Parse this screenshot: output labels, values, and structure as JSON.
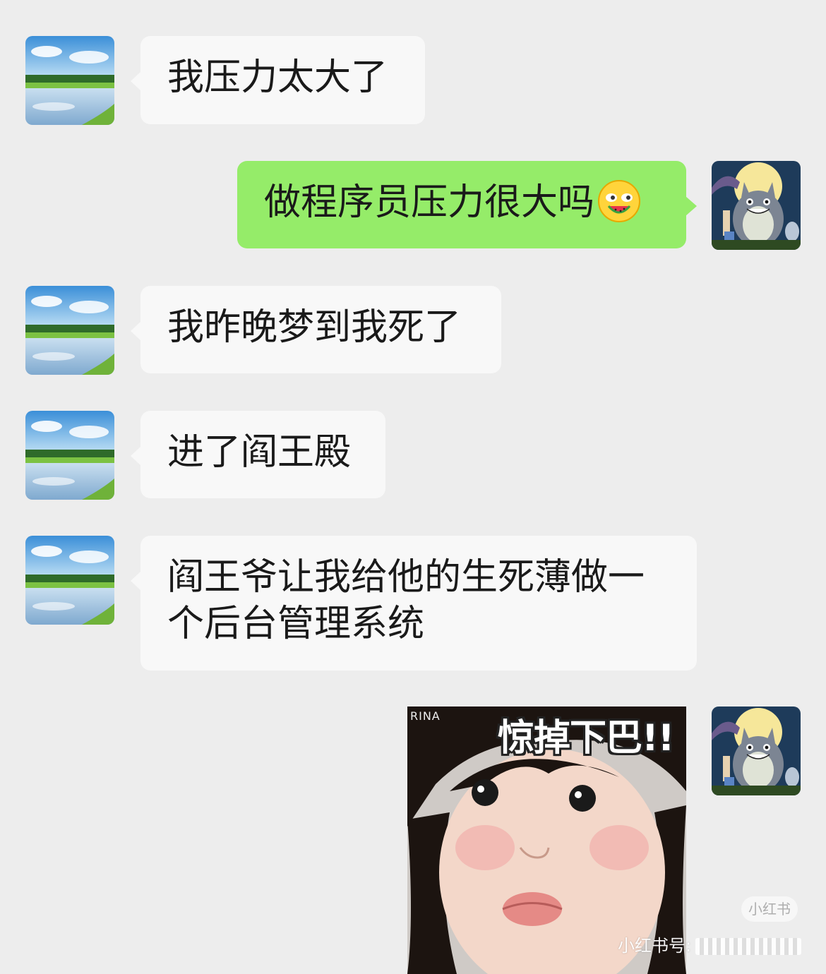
{
  "chat": {
    "messages": [
      {
        "side": "left",
        "text": "我压力太大了"
      },
      {
        "side": "right",
        "text": "做程序员压力很大吗",
        "emoji": "watermelon-eating-face-emoji"
      },
      {
        "side": "left",
        "text": "我昨晚梦到我死了"
      },
      {
        "side": "left",
        "text": "进了阎王殿"
      },
      {
        "side": "left",
        "text": "阎王爷让我给他的生死薄做一个后台管理系统"
      },
      {
        "side": "right",
        "type": "sticker",
        "caption": "惊掉下巴!!",
        "tag": "RINA"
      }
    ]
  },
  "avatars": {
    "contact": "lake-landscape-avatar",
    "self": "totoro-avatar"
  },
  "watermark": {
    "logo": "小红书",
    "id_label": "小红书号:"
  },
  "colors": {
    "background": "#ededed",
    "incoming_bubble": "#f8f8f8",
    "outgoing_bubble": "#95ec69"
  }
}
